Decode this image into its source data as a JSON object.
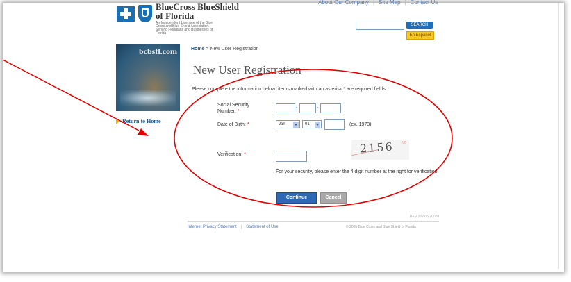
{
  "header": {
    "brand_line1": "BlueCross BlueShield",
    "brand_line2": "of Florida",
    "tagline": "An Independent Licensee of the Blue Cross and Blue Shield Association. Serving Floridians and Businesses of Florida",
    "top_links": [
      "About Our Company",
      "Site Map",
      "Contact Us"
    ],
    "search_label": "SEARCH",
    "espanol_label": "En Español"
  },
  "sidebar": {
    "photo_text": "bcbsfl.com",
    "return_link": "Return to Home"
  },
  "main": {
    "breadcrumb_home": "Home",
    "breadcrumb_sep": " > ",
    "breadcrumb_current": "New User Registration",
    "title": "New User Registration",
    "intro": "Please complete the information below; items marked with an asterisk * are required fields.",
    "ssn_label": "Social Security Number:",
    "dob_label": "Date of Birth:",
    "dob_month": "Jan",
    "dob_day": "01",
    "dob_year_hint": "(ex. 1973)",
    "verification_label": "Verification:",
    "captcha_text": "2156",
    "captcha_mark": "SP",
    "verification_note": "For your security, please enter the 4 digit number at the right for verification.",
    "continue_label": "Continue",
    "cancel_label": "Cancel",
    "page_code": "REV 202 06 2005a"
  },
  "footer": {
    "privacy_link": "Internet Privacy Statement",
    "terms_link": "Statement of Use",
    "copyright": "© 2005 Blue Cross and Blue Shield of Florida"
  },
  "colors": {
    "annotation_red": "#e00000",
    "brand_blue": "#1a6fb3",
    "continue_blue": "#2c68b3"
  }
}
